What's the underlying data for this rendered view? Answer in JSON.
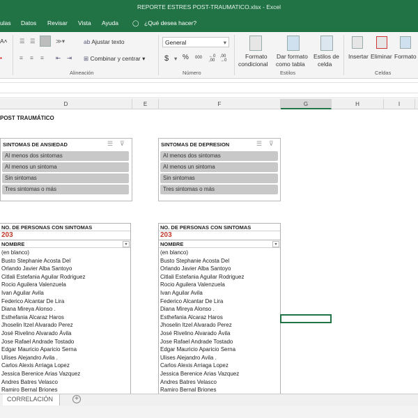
{
  "window": {
    "title": "REPORTE ESTRES POST-TRAUMATICO.xlsx  -  Excel"
  },
  "tabs": [
    "ulas",
    "Datos",
    "Revisar",
    "Vista",
    "Ayuda"
  ],
  "tell_me": "¿Qué desea hacer?",
  "ribbon": {
    "wrap_text": "Ajustar texto",
    "merge_center": "Combinar y centrar",
    "alignment_group": "Alineación",
    "number_format": "General",
    "number_group": "Número",
    "currency": "$",
    "percent": "%",
    "thousands": "000",
    "cond_format": "Formato",
    "cond_format2": "condicional",
    "format_table": "Dar formato",
    "format_table2": "como tabla",
    "cell_styles": "Estilos de",
    "cell_styles2": "celda",
    "styles_group": "Estilos",
    "insert": "Insertar",
    "delete": "Eliminar",
    "format": "Formato",
    "cells_group": "Celdas"
  },
  "columns": [
    "D",
    "E",
    "F",
    "G",
    "H",
    "I"
  ],
  "sheet_title": "POST TRAUMÁTICO",
  "slicers": [
    {
      "title": "SINTOMAS DE ANSIEDAD",
      "items": [
        "Al menos dos sintomas",
        "Al menos un sintoma",
        "Sin sintomas",
        "Tres sintomas o más"
      ]
    },
    {
      "title": "SINTOMAS DE DEPRESION",
      "items": [
        "Al menos dos sintomas",
        "Al menos un sintoma",
        "Sin sintomas",
        "Tres sintomas o más"
      ]
    }
  ],
  "tables": [
    {
      "header": "NO. DE PERSONAS CON SINTOMAS",
      "count": "203",
      "column": "NOMBRE"
    },
    {
      "header": "NO. DE PERSONAS CON SINTOMAS",
      "count": "203",
      "column": "NOMBRE"
    }
  ],
  "names": [
    "(en blanco)",
    "Busto Stephanie Acosta Del",
    "Orlando Javier Alba Santoyo",
    "Citlali Estefania Aguilar Rodriguez",
    "Rocio Aguilera Valenzuela",
    "Ivan Aguilar Avila",
    "Federico Alcantar De Lira",
    "Diana Mireya Alonso .",
    "Esthefania Alcaraz Haros",
    "Jhoselin Itzel Alvarado Perez",
    "José Rivelino Alvarado Ávila",
    "Jose Rafael Andrade Tostado",
    "Edgar Mauricio Aparicio Serna",
    "Ulises Alejandro Avila .",
    "Carlos Alexis Arriaga Lopez",
    "Jessica Berenice Arias Vazquez",
    "Andres Batres Velasco",
    "Ramiro Bernal Briones"
  ],
  "sheet_tabs": [
    "CORRELACIÓN"
  ],
  "colors": {
    "excel_green": "#217346",
    "count_red": "#c0392b",
    "slicer_item": "#c8c8c8"
  }
}
